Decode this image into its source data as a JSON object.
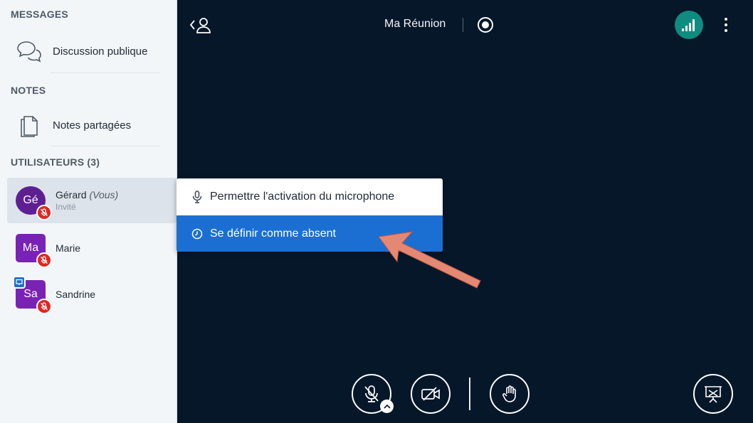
{
  "sidebar": {
    "messages_title": "MESSAGES",
    "public_chat_label": "Discussion publique",
    "notes_title": "NOTES",
    "shared_notes_label": "Notes partagées",
    "users_title": "UTILISATEURS (3)",
    "users": [
      {
        "initials": "Gé",
        "name": "Gérard",
        "you_suffix": "(Vous)",
        "role": "Invité",
        "avatar_color": "#5e1f93"
      },
      {
        "initials": "Ma",
        "name": "Marie",
        "avatar_color": "#7a22b5"
      },
      {
        "initials": "Sa",
        "name": "Sandrine",
        "avatar_color": "#7a22b5"
      }
    ]
  },
  "topbar": {
    "meeting_title": "Ma Réunion",
    "icons": [
      "user-list-toggle-icon",
      "record-icon",
      "connection-status-icon",
      "more-options-icon"
    ]
  },
  "menu": {
    "items": [
      {
        "label": "Permettre l'activation du microphone",
        "icon": "microphone-icon"
      },
      {
        "label": "Se définir comme absent",
        "icon": "clock-icon"
      }
    ],
    "selected_index": 1
  },
  "controls": {
    "icons": [
      "mute-microphone-icon",
      "camera-off-icon",
      "raise-hand-icon",
      "presentation-icon"
    ]
  },
  "colors": {
    "background": "#06172a",
    "sidebar_bg": "#f3f6f9",
    "accent_blue": "#1b6fd3",
    "mute_red": "#df2721",
    "connection_teal": "#0f8c7f",
    "annotation_arrow": "#e58873"
  }
}
